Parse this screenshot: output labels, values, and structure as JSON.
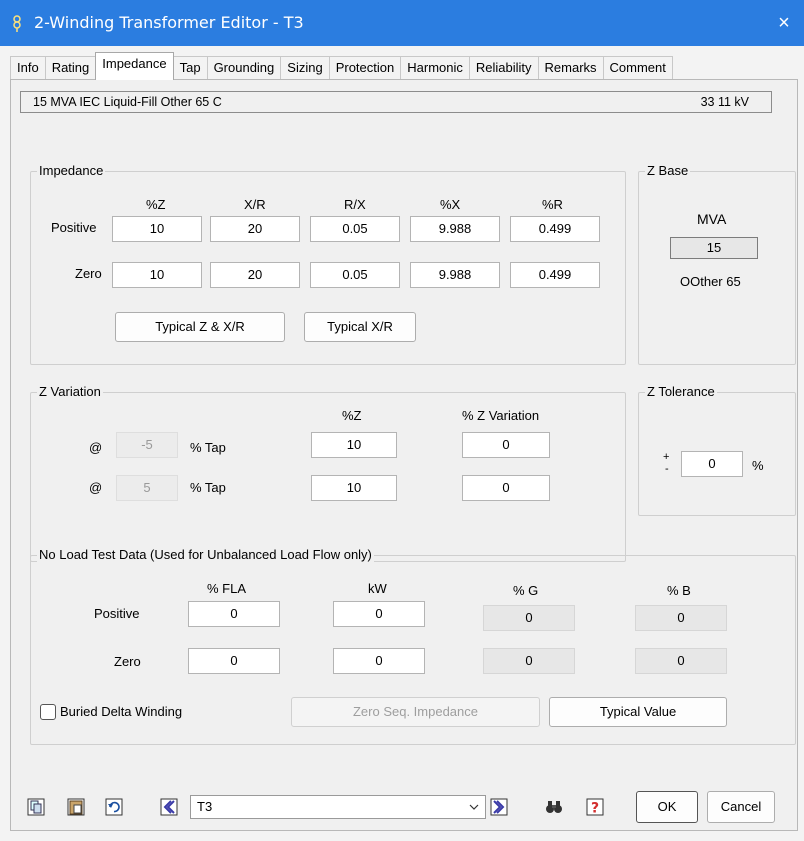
{
  "window": {
    "title": "2-Winding Transformer Editor - T3",
    "close": "×"
  },
  "tabs": [
    "Info",
    "Rating",
    "Impedance",
    "Tap",
    "Grounding",
    "Sizing",
    "Protection",
    "Harmonic",
    "Reliability",
    "Remarks",
    "Comment"
  ],
  "active_tab": "Impedance",
  "info_bar": {
    "left": "15 MVA  IEC  Liquid-Fill  Other  65 C",
    "right": "33   11 kV"
  },
  "impedance": {
    "legend": "Impedance",
    "headers": [
      "%Z",
      "X/R",
      "R/X",
      "%X",
      "%R"
    ],
    "positive": {
      "label": "Positive",
      "values": [
        "10",
        "20",
        "0.05",
        "9.988",
        "0.499"
      ]
    },
    "zero": {
      "label": "Zero",
      "values": [
        "10",
        "20",
        "0.05",
        "9.988",
        "0.499"
      ]
    },
    "btn_typical_z_xr": "Typical Z & X/R",
    "btn_typical_xr": "Typical  X/R"
  },
  "zbase": {
    "legend": "Z Base",
    "unit": "MVA",
    "value": "15",
    "note": "OOther 65"
  },
  "zvariation": {
    "legend": "Z Variation",
    "col_z": "%Z",
    "col_var": "% Z Variation",
    "rows": [
      {
        "at": "@",
        "tap": "-5",
        "tap_label": "% Tap",
        "z": "10",
        "var": "0"
      },
      {
        "at": "@",
        "tap": "5",
        "tap_label": "% Tap",
        "z": "10",
        "var": "0"
      }
    ]
  },
  "ztolerance": {
    "legend": "Z Tolerance",
    "plus": "+",
    "minus": "-",
    "value": "0",
    "unit": "%"
  },
  "noload": {
    "legend": "No Load Test Data (Used for Unbalanced Load Flow only)",
    "headers": [
      "% FLA",
      "kW",
      "% G",
      "% B"
    ],
    "positive": {
      "label": "Positive",
      "values": [
        "0",
        "0",
        "0",
        "0"
      ]
    },
    "zero": {
      "label": "Zero",
      "values": [
        "0",
        "0",
        "0",
        "0"
      ]
    },
    "buried_delta_label": "Buried Delta Winding",
    "btn_zero_seq": "Zero Seq. Impedance",
    "btn_typical_value": "Typical Value"
  },
  "footer": {
    "selector_value": "T3",
    "ok": "OK",
    "cancel": "Cancel"
  },
  "colors": {
    "titlebar": "#2b7de0",
    "help_icon": "#d32f2f",
    "nav_icon": "#3a3aa8"
  }
}
